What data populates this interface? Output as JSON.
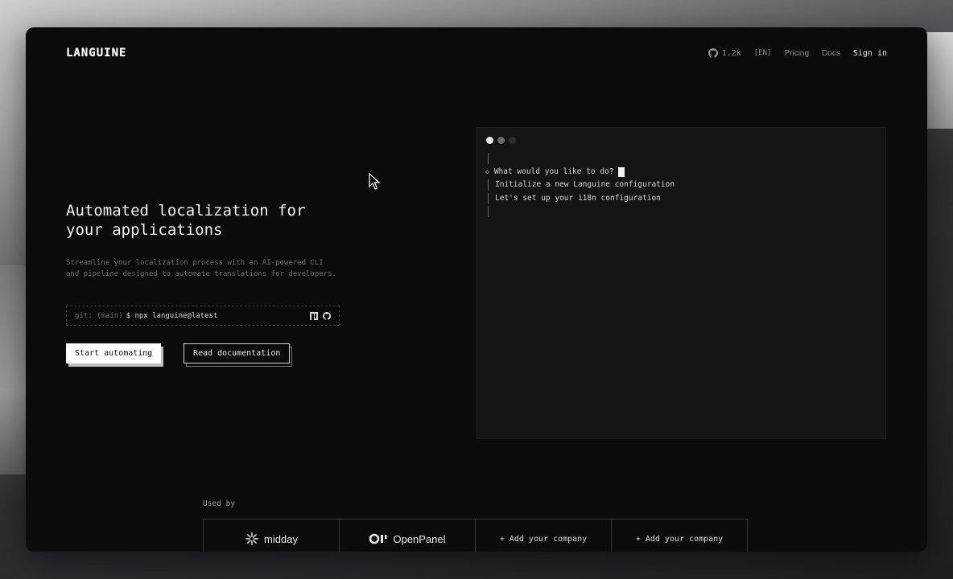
{
  "nav": {
    "logo": "LANGUINE",
    "github_stars": "1.2k",
    "language": "[EN]",
    "pricing": "Pricing",
    "docs": "Docs",
    "sign_in": "Sign in"
  },
  "hero": {
    "title": "Automated localization for your applications",
    "subtitle": "Streamline your localization process with an AI-powered CLI and pipeline designed to automate translations for developers.",
    "cli_prompt": "git: (main)",
    "cli_command": "$ npx languine@latest",
    "primary_button": "Start automating",
    "secondary_button": "Read documentation"
  },
  "terminal": {
    "question": "What would you like to do?",
    "option_1": "Initialize a new Languine configuration",
    "option_2": "Let's set up your i18n configuration"
  },
  "used_by": {
    "label": "Used by",
    "companies": [
      {
        "name": "midday",
        "icon": "midday-logo-icon"
      },
      {
        "name": "OpenPanel",
        "icon": "openpanel-logo-icon"
      },
      {
        "name": "+ Add your company"
      },
      {
        "name": "+ Add your company"
      }
    ]
  },
  "colors": {
    "window_bg": "#0b0b0b",
    "terminal_bg": "#141414",
    "text_primary": "#f2f2f2",
    "text_muted": "#6f6f6f"
  }
}
